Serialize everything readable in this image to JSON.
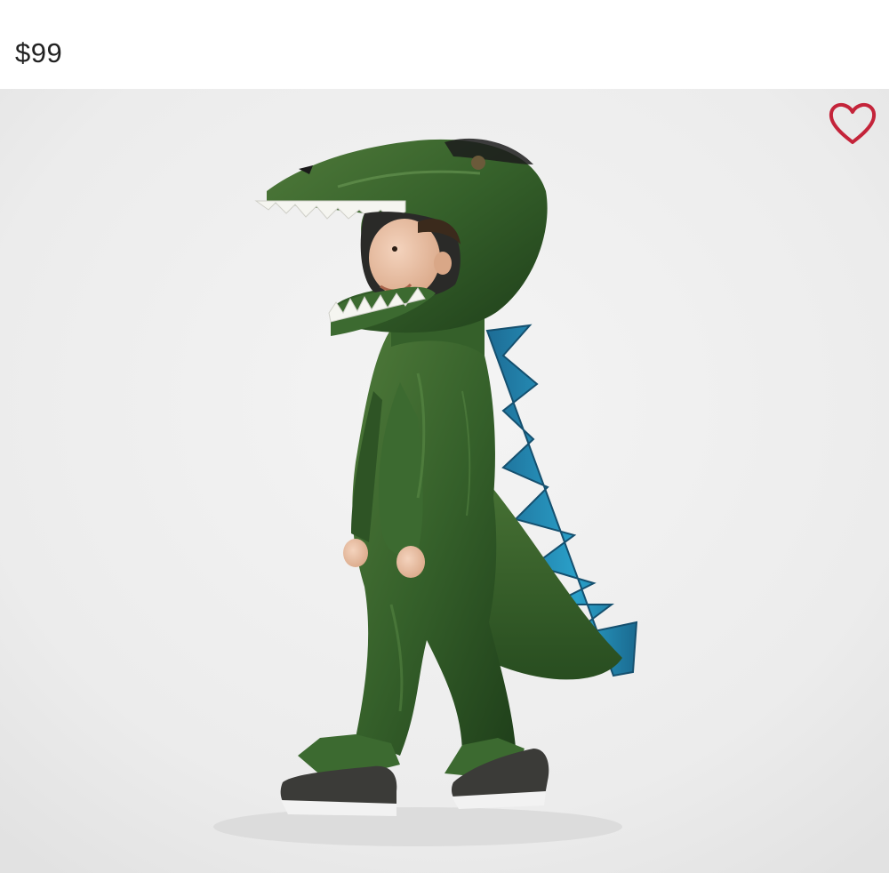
{
  "product": {
    "price": "$99"
  },
  "favorite": {
    "icon": "heart-outline-icon",
    "color": "#c4243a"
  },
  "photo": {
    "icon": "product-photo"
  }
}
